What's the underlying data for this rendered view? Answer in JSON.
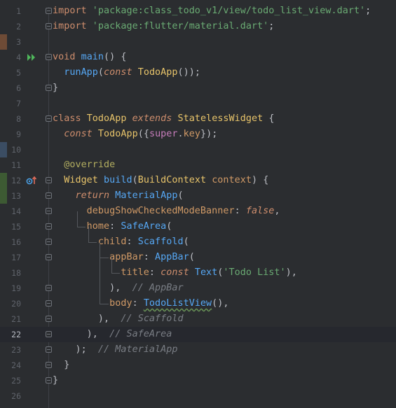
{
  "editor": {
    "current_line": 22,
    "lines": [
      {
        "n": "1",
        "tokens": [
          {
            "t": "import",
            "c": "kw"
          },
          {
            "t": " "
          },
          {
            "t": "'package:class_todo_v1/view/todo_list_view.dart'",
            "c": "str"
          },
          {
            "t": ";"
          }
        ]
      },
      {
        "n": "2",
        "tokens": [
          {
            "t": "import",
            "c": "kw"
          },
          {
            "t": " "
          },
          {
            "t": "'package:flutter/material.dart'",
            "c": "str"
          },
          {
            "t": ";"
          }
        ]
      },
      {
        "n": "3",
        "tokens": []
      },
      {
        "n": "4",
        "tokens": [
          {
            "t": "void",
            "c": "kw"
          },
          {
            "t": " "
          },
          {
            "t": "main",
            "c": "fn"
          },
          {
            "t": "() {"
          }
        ]
      },
      {
        "n": "5",
        "tokens": [
          {
            "t": "  "
          },
          {
            "t": "runApp",
            "c": "fn"
          },
          {
            "t": "("
          },
          {
            "t": "const",
            "c": "kwi"
          },
          {
            "t": " "
          },
          {
            "t": "TodoApp",
            "c": "cls"
          },
          {
            "t": "());"
          }
        ]
      },
      {
        "n": "6",
        "tokens": [
          {
            "t": "}"
          }
        ]
      },
      {
        "n": "7",
        "tokens": []
      },
      {
        "n": "8",
        "tokens": [
          {
            "t": "class",
            "c": "kw"
          },
          {
            "t": " "
          },
          {
            "t": "TodoApp",
            "c": "cls"
          },
          {
            "t": " "
          },
          {
            "t": "extends",
            "c": "kwi"
          },
          {
            "t": " "
          },
          {
            "t": "StatelessWidget",
            "c": "cls"
          },
          {
            "t": " {"
          }
        ]
      },
      {
        "n": "9",
        "tokens": [
          {
            "t": "  "
          },
          {
            "t": "const",
            "c": "kwi"
          },
          {
            "t": " "
          },
          {
            "t": "TodoApp",
            "c": "cls"
          },
          {
            "t": "({"
          },
          {
            "t": "super",
            "c": "prm"
          },
          {
            "t": "."
          },
          {
            "t": "key",
            "c": "named"
          },
          {
            "t": "});"
          }
        ]
      },
      {
        "n": "10",
        "tokens": []
      },
      {
        "n": "11",
        "tokens": [
          {
            "t": "  "
          },
          {
            "t": "@override",
            "c": "ann"
          }
        ]
      },
      {
        "n": "12",
        "tokens": [
          {
            "t": "  "
          },
          {
            "t": "Widget",
            "c": "cls"
          },
          {
            "t": " "
          },
          {
            "t": "build",
            "c": "fn"
          },
          {
            "t": "("
          },
          {
            "t": "BuildContext",
            "c": "cls"
          },
          {
            "t": " "
          },
          {
            "t": "context",
            "c": "named"
          },
          {
            "t": ") {"
          }
        ]
      },
      {
        "n": "13",
        "tokens": [
          {
            "t": "    "
          },
          {
            "t": "return",
            "c": "kwi"
          },
          {
            "t": " "
          },
          {
            "t": "MaterialApp",
            "c": "fn"
          },
          {
            "t": "("
          }
        ]
      },
      {
        "n": "14",
        "tokens": [
          {
            "t": "      "
          },
          {
            "t": "debugShowCheckedModeBanner",
            "c": "named"
          },
          {
            "t": ": "
          },
          {
            "t": "false",
            "c": "lit"
          },
          {
            "t": ","
          }
        ]
      },
      {
        "n": "15",
        "tokens": [
          {
            "t": "      "
          },
          {
            "t": "home",
            "c": "named"
          },
          {
            "t": ": "
          },
          {
            "t": "SafeArea",
            "c": "fn"
          },
          {
            "t": "("
          }
        ]
      },
      {
        "n": "16",
        "tokens": [
          {
            "t": "        "
          },
          {
            "t": "child",
            "c": "named"
          },
          {
            "t": ": "
          },
          {
            "t": "Scaffold",
            "c": "fn"
          },
          {
            "t": "("
          }
        ]
      },
      {
        "n": "17",
        "tokens": [
          {
            "t": "          "
          },
          {
            "t": "appBar",
            "c": "named"
          },
          {
            "t": ": "
          },
          {
            "t": "AppBar",
            "c": "fn"
          },
          {
            "t": "("
          }
        ]
      },
      {
        "n": "18",
        "tokens": [
          {
            "t": "            "
          },
          {
            "t": "title",
            "c": "named"
          },
          {
            "t": ": "
          },
          {
            "t": "const",
            "c": "kwi"
          },
          {
            "t": " "
          },
          {
            "t": "Text",
            "c": "fn"
          },
          {
            "t": "("
          },
          {
            "t": "'Todo List'",
            "c": "str"
          },
          {
            "t": "),"
          }
        ]
      },
      {
        "n": "19",
        "tokens": [
          {
            "t": "          "
          },
          {
            "t": "),"
          },
          {
            "t": "  "
          },
          {
            "t": "// AppBar",
            "c": "cmt"
          }
        ]
      },
      {
        "n": "20",
        "tokens": [
          {
            "t": "          "
          },
          {
            "t": "body",
            "c": "named"
          },
          {
            "t": ": "
          },
          {
            "t": "TodoListView",
            "c": "fn",
            "u": true
          },
          {
            "t": "(),"
          }
        ]
      },
      {
        "n": "21",
        "tokens": [
          {
            "t": "        "
          },
          {
            "t": "),"
          },
          {
            "t": "  "
          },
          {
            "t": "// Scaffold",
            "c": "cmt"
          }
        ]
      },
      {
        "n": "22",
        "tokens": [
          {
            "t": "      "
          },
          {
            "t": "),"
          },
          {
            "t": "  "
          },
          {
            "t": "// SafeArea",
            "c": "cmt"
          }
        ]
      },
      {
        "n": "23",
        "tokens": [
          {
            "t": "    "
          },
          {
            "t": ");"
          },
          {
            "t": "  "
          },
          {
            "t": "// MaterialApp",
            "c": "cmt"
          }
        ]
      },
      {
        "n": "24",
        "tokens": [
          {
            "t": "  "
          },
          {
            "t": "}"
          }
        ]
      },
      {
        "n": "25",
        "tokens": [
          {
            "t": "}"
          }
        ]
      },
      {
        "n": "26",
        "tokens": []
      }
    ],
    "gutter_icons": [
      {
        "line": 4,
        "icon": "run-icon",
        "color": "#4fb85b"
      },
      {
        "line": 12,
        "icon": "override-icon",
        "color": "#4a9fe3"
      }
    ],
    "fold_markers": [
      1,
      2,
      4,
      6,
      8,
      12,
      13,
      14,
      15,
      16,
      17,
      19,
      20,
      21,
      22,
      23,
      24,
      25
    ],
    "change_markers": [
      {
        "from": 3,
        "to": 3,
        "color": "#6e4b36"
      },
      {
        "from": 10,
        "to": 10,
        "color": "#3b4d63"
      },
      {
        "from": 12,
        "to": 13,
        "color": "#3d5a33"
      }
    ],
    "colors": {
      "background": "#2b2d30",
      "keyword": "#cf8e6d",
      "string": "#6aab73",
      "function": "#56a8f5",
      "class": "#e8c46a",
      "named_argument": "#d19a66",
      "annotation": "#b3ae60",
      "comment": "#7a7e85"
    }
  }
}
